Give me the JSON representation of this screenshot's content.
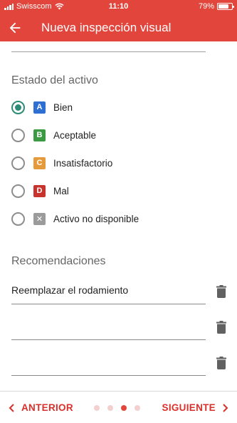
{
  "status_bar": {
    "carrier": "Swisscom",
    "time": "11:10",
    "battery": "79%",
    "battery_level": 0.79
  },
  "app_bar": {
    "title": "Nueva inspección visual",
    "back_icon": "arrow-left-icon"
  },
  "colors": {
    "brand": "#e2453c",
    "radio_selected": "#2e8b77",
    "nav_text": "#d9302c",
    "badge_a": "#2d6fd2",
    "badge_b": "#3c9a43",
    "badge_c": "#e59a3b",
    "badge_d": "#c9332e",
    "badge_x": "#9b9b9b"
  },
  "estado": {
    "title": "Estado del activo",
    "selected_index": 0,
    "options": [
      {
        "badge": "A",
        "label": "Bien"
      },
      {
        "badge": "B",
        "label": "Aceptable"
      },
      {
        "badge": "C",
        "label": "Insatisfactorio"
      },
      {
        "badge": "D",
        "label": "Mal"
      },
      {
        "badge": "✕",
        "label": "Activo no disponible"
      }
    ]
  },
  "recomendaciones": {
    "title": "Recomendaciones",
    "items": [
      {
        "value": "Reemplazar el rodamiento"
      },
      {
        "value": ""
      },
      {
        "value": ""
      }
    ],
    "delete_icon": "trash-icon"
  },
  "footer": {
    "prev_label": "ANTERIOR",
    "next_label": "SIGUIENTE",
    "page_count": 4,
    "current_page": 3
  }
}
